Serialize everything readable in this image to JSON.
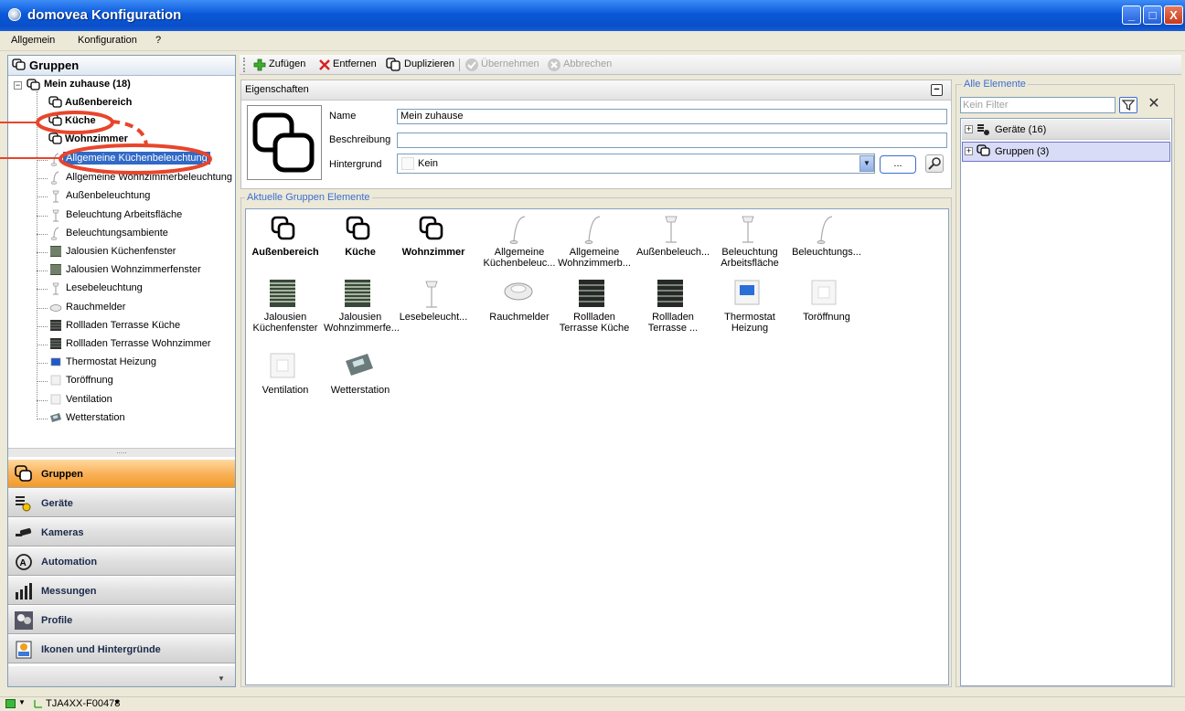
{
  "window": {
    "title": "domovea Konfiguration",
    "minimize": "_",
    "maximize": "□",
    "close": "X"
  },
  "menu": {
    "items": [
      "Allgemein",
      "Konfiguration",
      "?"
    ]
  },
  "left_panel": {
    "title": "Gruppen",
    "root": "Mein zuhause (18)",
    "groups": [
      "Außenbereich",
      "Küche",
      "Wohnzimmer"
    ],
    "items": [
      {
        "label": "Allgemeine Küchenbeleuchtung",
        "icon": "pendant-lamp-icon",
        "selected": true
      },
      {
        "label": "Allgemeine Wohnzimmerbeleuchtung",
        "icon": "pendant-lamp-icon"
      },
      {
        "label": "Außenbeleuchtung",
        "icon": "floor-lamp-icon"
      },
      {
        "label": "Beleuchtung Arbeitsfläche",
        "icon": "floor-lamp-icon"
      },
      {
        "label": "Beleuchtungsambiente",
        "icon": "pendant-lamp-icon"
      },
      {
        "label": "Jalousien Küchenfenster",
        "icon": "blind-icon"
      },
      {
        "label": "Jalousien Wohnzimmerfenster",
        "icon": "blind-icon"
      },
      {
        "label": "Lesebeleuchtung",
        "icon": "floor-lamp-icon"
      },
      {
        "label": "Rauchmelder",
        "icon": "smoke-detector-icon"
      },
      {
        "label": "Rollladen Terrasse Küche",
        "icon": "shutter-icon"
      },
      {
        "label": "Rollladen Terrasse Wohnzimmer",
        "icon": "shutter-icon"
      },
      {
        "label": "Thermostat Heizung",
        "icon": "thermostat-icon"
      },
      {
        "label": "Toröffnung",
        "icon": "switch-icon"
      },
      {
        "label": "Ventilation",
        "icon": "switch-icon"
      },
      {
        "label": "Wetterstation",
        "icon": "weather-station-icon"
      }
    ],
    "splitter": "....."
  },
  "nav": [
    {
      "label": "Gruppen",
      "icon": "groups-icon",
      "active": true
    },
    {
      "label": "Geräte",
      "icon": "devices-icon"
    },
    {
      "label": "Kameras",
      "icon": "camera-icon"
    },
    {
      "label": "Automation",
      "icon": "automation-icon"
    },
    {
      "label": "Messungen",
      "icon": "measurements-icon"
    },
    {
      "label": "Profile",
      "icon": "profiles-icon"
    },
    {
      "label": "Ikonen und Hintergründe",
      "icon": "icons-backgrounds-icon"
    }
  ],
  "toolbar": {
    "add": "Zufügen",
    "remove": "Entfernen",
    "duplicate": "Duplizieren",
    "apply": "Übernehmen",
    "cancel": "Abbrechen"
  },
  "properties": {
    "title": "Eigenschaften",
    "name_label": "Name",
    "name_value": "Mein zuhause",
    "description_label": "Beschreibung",
    "description_value": "",
    "background_label": "Hintergrund",
    "background_value": "Kein",
    "browse_label": "..."
  },
  "group_elements": {
    "title": "Aktuelle Gruppen Elemente",
    "row1": [
      {
        "label": "Außenbereich",
        "icon": "group-icon",
        "bold": true
      },
      {
        "label": "Küche",
        "icon": "group-icon",
        "bold": true
      },
      {
        "label": "Wohnzimmer",
        "icon": "group-icon",
        "bold": true
      },
      {
        "label": "Allgemeine Küchenbeleuc...",
        "icon": "pendant-lamp-icon"
      },
      {
        "label": "Allgemeine Wohnzimmerb...",
        "icon": "pendant-lamp-icon"
      },
      {
        "label": "Außenbeleuch...",
        "icon": "floor-lamp-icon"
      },
      {
        "label": "Beleuchtung Arbeitsfläche",
        "icon": "floor-lamp-icon"
      },
      {
        "label": "Beleuchtungs...",
        "icon": "pendant-lamp-icon"
      }
    ],
    "row2": [
      {
        "label": "Jalousien Küchenfenster",
        "icon": "blind-icon"
      },
      {
        "label": "Jalousien Wohnzimmerfe...",
        "icon": "blind-icon"
      },
      {
        "label": "Lesebeleucht...",
        "icon": "floor-lamp-icon"
      },
      {
        "label": "Rauchmelder",
        "icon": "smoke-detector-icon"
      },
      {
        "label": "Rollladen Terrasse Küche",
        "icon": "shutter-icon"
      },
      {
        "label": "Rollladen Terrasse ...",
        "icon": "shutter-icon"
      },
      {
        "label": "Thermostat Heizung",
        "icon": "thermostat-icon"
      },
      {
        "label": "Toröffnung",
        "icon": "switch-icon"
      }
    ],
    "row3": [
      {
        "label": "Ventilation",
        "icon": "switch-icon"
      },
      {
        "label": "Wetterstation",
        "icon": "weather-station-icon"
      }
    ]
  },
  "all_elements": {
    "title": "Alle Elemente",
    "filter_placeholder": "Kein Filter",
    "rows": [
      {
        "label": "Geräte (16)",
        "icon": "devices-icon"
      },
      {
        "label": "Gruppen (3)",
        "icon": "group-icon",
        "selected": true
      }
    ]
  },
  "statusbar": {
    "connection": "TJA4XX-F00478"
  },
  "colors": {
    "accent": "#f39a2a",
    "selection": "#3169c6",
    "annotation": "#e8452b",
    "legend": "#3c6ed0"
  }
}
